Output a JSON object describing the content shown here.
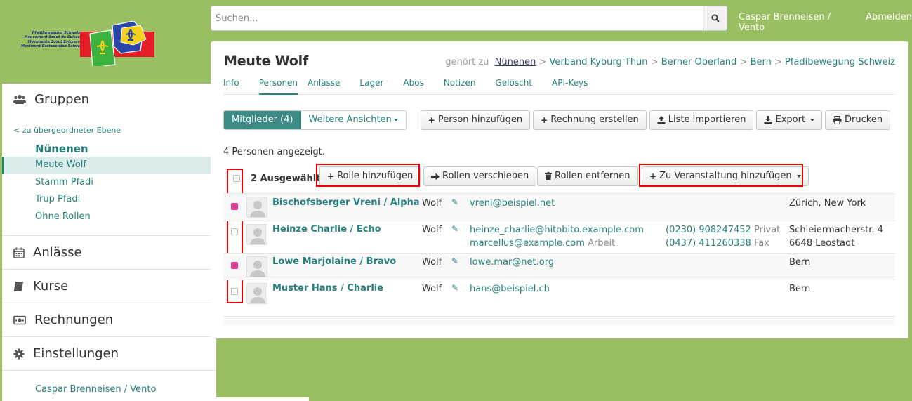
{
  "search": {
    "placeholder": "Suchen..."
  },
  "topnav": {
    "user": "Caspar Brenneisen / Vento",
    "logout": "Abmelden"
  },
  "logo": {
    "lines": [
      "Pfadibewegung Schweiz",
      "Mouvement Scout de Suisse",
      "Movimento Scout Svizzero",
      "Moviment Battasendas Svizra"
    ]
  },
  "sidebar": {
    "sections": [
      {
        "label": "Gruppen",
        "icon": "users-icon"
      },
      {
        "label": "Anlässe",
        "icon": "calendar-icon"
      },
      {
        "label": "Kurse",
        "icon": "book-icon"
      },
      {
        "label": "Rechnungen",
        "icon": "money-icon"
      },
      {
        "label": "Einstellungen",
        "icon": "gear-icon"
      }
    ],
    "back": "< zu übergeordneter Ebene",
    "group": "Nünenen",
    "items": [
      "Meute Wolf",
      "Stamm Pfadi",
      "Trup Pfadi",
      "Ohne Rollen"
    ],
    "user": "Caspar Brenneisen / Vento"
  },
  "page": {
    "title": "Meute Wolf",
    "belongs": "gehört zu",
    "crumbs": [
      "Nünenen",
      "Verband Kyburg Thun",
      "Berner Oberland",
      "Bern",
      "Pfadibewegung Schweiz"
    ],
    "sep": ">",
    "tabs": [
      "Info",
      "Personen",
      "Anlässe",
      "Lager",
      "Abos",
      "Notizen",
      "Gelöscht",
      "API-Keys"
    ]
  },
  "toolbar": {
    "members": "Mitglieder (4)",
    "more_views": "Weitere Ansichten",
    "add_person": "Person hinzufügen",
    "create_invoice": "Rechnung erstellen",
    "import_list": "Liste importieren",
    "export": "Export",
    "print": "Drucken"
  },
  "count": "4 Personen angezeigt.",
  "actions": {
    "selected": "2 Ausgewählt",
    "add_role": "Rolle hinzufügen",
    "move_roles": "Rollen verschieben",
    "remove_roles": "Rollen entfernen",
    "add_event": "Zu Veranstaltung hinzufügen"
  },
  "people": [
    {
      "name": "Bischofsberger Vreni / Alpha",
      "role": "Wolf",
      "checked": true,
      "emails": [
        {
          "addr": "vreni@beispiel.net",
          "label": ""
        }
      ],
      "phones": [],
      "address": [
        "Zürich, New York"
      ]
    },
    {
      "name": "Heinze Charlie / Echo",
      "role": "Wolf",
      "checked": false,
      "emails": [
        {
          "addr": "heinze_charlie@hitobito.example.com",
          "label": ""
        },
        {
          "addr": "marcellus@example.com",
          "label": "Arbeit"
        }
      ],
      "phones": [
        {
          "num": "(0230) 908247452",
          "label": "Privat"
        },
        {
          "num": "(0437) 411260338",
          "label": "Fax"
        }
      ],
      "address": [
        "Schleiermacherstr. 4",
        "6648 Leostadt"
      ]
    },
    {
      "name": "Lowe Marjolaine / Bravo",
      "role": "Wolf",
      "checked": true,
      "emails": [
        {
          "addr": "lowe.mar@net.org",
          "label": ""
        }
      ],
      "phones": [],
      "address": [
        "Bern"
      ]
    },
    {
      "name": "Muster Hans / Charlie",
      "role": "Wolf",
      "checked": false,
      "emails": [
        {
          "addr": "hans@beispiel.ch",
          "label": ""
        }
      ],
      "phones": [],
      "address": [
        "Bern"
      ]
    }
  ]
}
